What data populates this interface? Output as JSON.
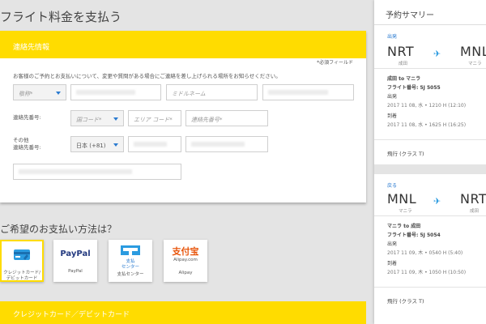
{
  "page": {
    "title": "フライト料金を支払う"
  },
  "contact": {
    "header": "連絡先情報",
    "required_note": "*必須フィールド",
    "intro": "お客様のご予約とお支払いについて、変更や質問がある場合にご連絡を差し上げられる場所をお知らせください。",
    "title_select": "敬称*",
    "middle_name_placeholder": "ミドルネーム",
    "phone_label": "連絡先番号:",
    "country_code_select": "国コード*",
    "area_code_placeholder": "エリア コード*",
    "phone_number_placeholder": "連絡先番号*",
    "other_phone_label_line1": "その他",
    "other_phone_label_line2": "連絡先番号:",
    "other_country_select": "日本 (+81)"
  },
  "payment": {
    "title": "ご希望のお支払い方法は？",
    "options": [
      {
        "label": "クレジットカード/デビットカード",
        "icon": "credit-card-icon",
        "selected": true
      },
      {
        "label": "PayPal",
        "icon": "paypal-logo"
      },
      {
        "label": "支払センター",
        "icon": "payment-center-icon"
      },
      {
        "label": "Alipay",
        "icon": "alipay-logo",
        "logo_text": "支付宝",
        "logo_sub": "Alipay.com"
      }
    ],
    "paypal_logo_text": "PayPal",
    "center_icon_text_line1": "支払",
    "center_icon_text_line2": "センター",
    "card_section_header": "クレジットカード／デビットカード"
  },
  "summary": {
    "title": "予約サマリー",
    "legs": [
      {
        "tag": "出発",
        "from_code": "NRT",
        "from_city": "成田",
        "to_code": "MNL",
        "to_city": "マニラ",
        "route": "成田 to マニラ",
        "flight": "フライト番号: 5J 5055",
        "dep_label": "出発",
        "dep_time": "2017 11 08, 水 • 1210 H (12:10)",
        "arr_label": "到着",
        "arr_time": "2017 11 08, 水 • 1625 H (16:25)",
        "cabin": "飛行 (クラス T)"
      },
      {
        "tag": "戻る",
        "from_code": "MNL",
        "from_city": "マニラ",
        "to_code": "NRT",
        "to_city": "成田",
        "route": "マニラ to 成田",
        "flight": "フライト番号: 5J 5054",
        "dep_label": "出発",
        "dep_time": "2017 11 09, 木 • 0540 H (5:40)",
        "arr_label": "到着",
        "arr_time": "2017 11 09, 木 • 1050 H (10:50)",
        "cabin": "飛行 (クラス T)"
      }
    ]
  },
  "colors": {
    "accent_yellow": "#ffdc00",
    "link_blue": "#2b7bd0",
    "background": "#e4e4e4"
  }
}
